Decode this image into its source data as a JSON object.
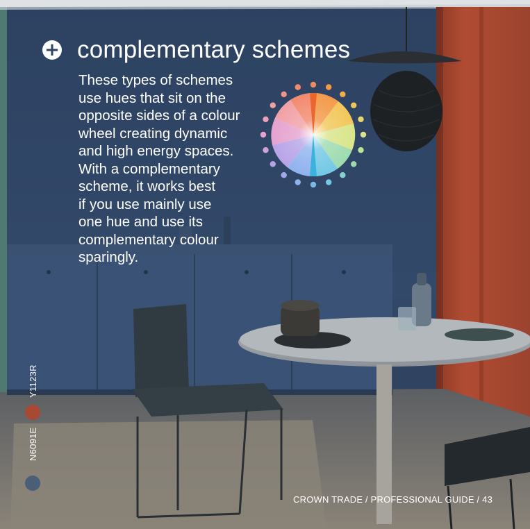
{
  "heading": {
    "icon": "plus-circle-icon",
    "title": "complementary schemes"
  },
  "body_lines": [
    "These types of schemes",
    "use hues that sit on the",
    "opposite sides of a colour",
    "wheel creating dynamic",
    "and high energy spaces.",
    "With a complementary",
    "scheme, it works best",
    "if you use mainly use",
    "one hue and use its",
    "complementary colour",
    "sparingly."
  ],
  "swatches": [
    {
      "code": "Y1123R",
      "color": "#a84a33"
    },
    {
      "code": "N6091E",
      "color": "#4a5e78"
    }
  ],
  "footer": "CROWN TRADE  /  PROFESSIONAL GUIDE  /  43",
  "colors": {
    "wall": "#2f4360",
    "accent_wall": "#a9472f",
    "floor": "#6b6862",
    "text": "#ffffff"
  }
}
